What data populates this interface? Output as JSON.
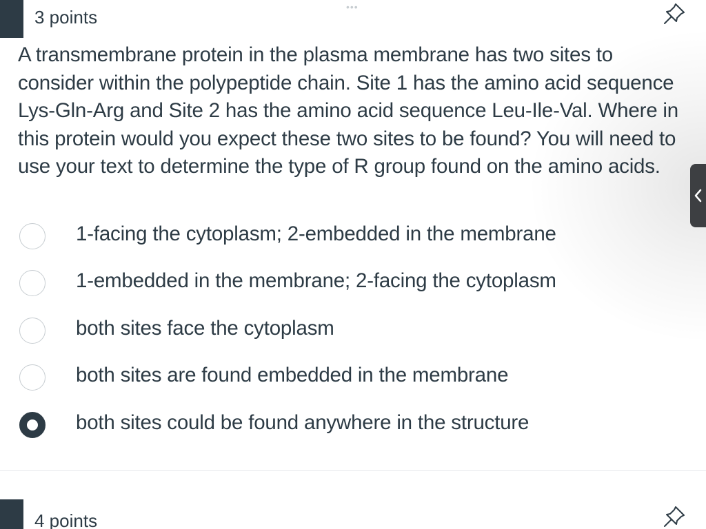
{
  "question1": {
    "points": "3 points",
    "text": "A transmembrane protein in the plasma membrane has two sites to consider within the polypeptide chain. Site 1 has the amino acid sequence Lys-Gln-Arg and Site 2 has the amino acid sequence Leu-Ile-Val. Where in this protein would you expect these two sites to be found? You will need to use your text to determine the type of R group found on the amino acids.",
    "answers": [
      {
        "label": "1-facing the cytoplasm; 2-embedded in the membrane",
        "selected": false
      },
      {
        "label": "1-embedded in the membrane; 2-facing the cytoplasm",
        "selected": false
      },
      {
        "label": "both sites face the cytoplasm",
        "selected": false
      },
      {
        "label": "both sites are found embedded in the membrane",
        "selected": false
      },
      {
        "label": "both sites could be found anywhere in the structure",
        "selected": true
      }
    ],
    "pin_icon": "pin-icon"
  },
  "question2": {
    "points": "4 points",
    "pin_icon": "pin-icon"
  },
  "top_indicator": "•••",
  "drawer_icon": "chevron-left-icon",
  "colors": {
    "text": "#2d3b45",
    "tab": "#2d3b45",
    "radio_border": "#c7cdd1",
    "drawer": "#3d3f42"
  }
}
